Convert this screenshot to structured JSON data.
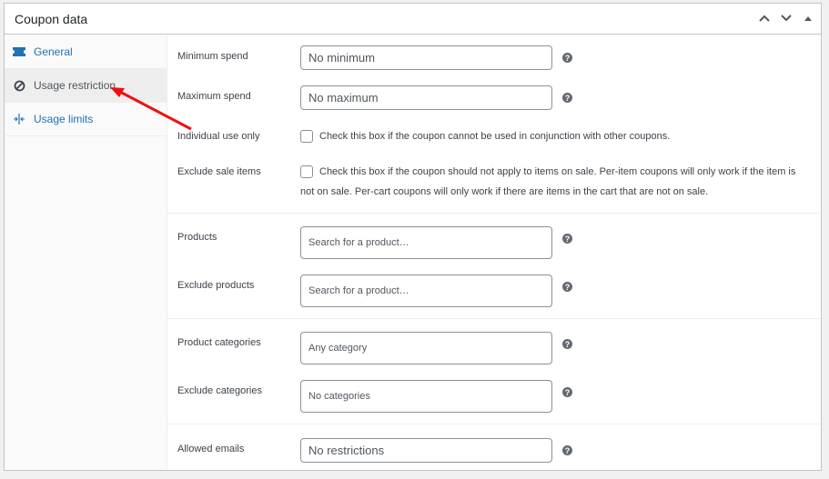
{
  "panel": {
    "title": "Coupon data",
    "actions": [
      {
        "name": "move-up",
        "icon": "chevron-up-icon"
      },
      {
        "name": "move-down",
        "icon": "chevron-down-icon"
      },
      {
        "name": "toggle-panel",
        "icon": "triangle-up-icon"
      }
    ]
  },
  "tabs": [
    {
      "label": "General",
      "icon": "ticket-icon",
      "active": false
    },
    {
      "label": "Usage restriction",
      "icon": "block-icon",
      "active": true
    },
    {
      "label": "Usage limits",
      "icon": "limits-icon",
      "active": false
    }
  ],
  "fields": {
    "minimum_spend": {
      "label": "Minimum spend",
      "placeholder": "No minimum",
      "help": "?"
    },
    "maximum_spend": {
      "label": "Maximum spend",
      "placeholder": "No maximum",
      "help": "?"
    },
    "individual_use": {
      "label": "Individual use only",
      "description": "Check this box if the coupon cannot be used in conjunction with other coupons.",
      "checked": false
    },
    "exclude_sale_items": {
      "label": "Exclude sale items",
      "description": "Check this box if the coupon should not apply to items on sale. Per-item coupons will only work if the item is not on sale. Per-cart coupons will only work if there are items in the cart that are not on sale.",
      "checked": false
    },
    "products": {
      "label": "Products",
      "placeholder": "Search for a product…",
      "help": "?"
    },
    "exclude_products": {
      "label": "Exclude products",
      "placeholder": "Search for a product…",
      "help": "?"
    },
    "product_categories": {
      "label": "Product categories",
      "placeholder": "Any category",
      "help": "?"
    },
    "exclude_categories": {
      "label": "Exclude categories",
      "placeholder": "No categories",
      "help": "?"
    },
    "allowed_emails": {
      "label": "Allowed emails",
      "placeholder": "No restrictions",
      "help": "?"
    }
  },
  "annotation": {
    "type": "arrow",
    "color": "#ee1111",
    "points_to": "Usage restriction tab"
  }
}
